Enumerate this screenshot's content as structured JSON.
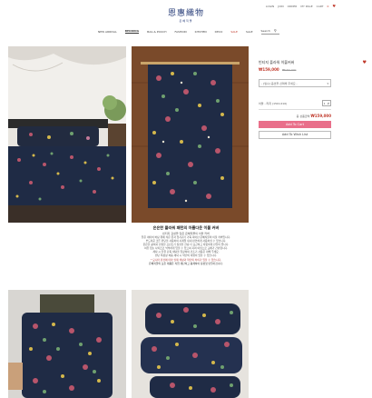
{
  "util": {
    "links": [
      "LOGIN",
      "JOIN",
      "ORDER",
      "MY PAGE",
      "CART"
    ],
    "cart_count": "0",
    "wish_icon": "heart-icon"
  },
  "logo": {
    "title": "恩惠織物",
    "subtitle": "은혜직물"
  },
  "nav": {
    "items": [
      "NEW ARRIVAL",
      "BEDDING",
      "BAG & POUCH",
      "FASHION",
      "KITCHEN",
      "DECO",
      "SALE",
      "SALE"
    ],
    "active_index": 1,
    "search_label": "Search",
    "search_icon": "magnifier-icon"
  },
  "product": {
    "name": "빈티지 플라워 이불커버",
    "price": "₩159,000",
    "original_price": "₩180,000",
    "select_placeholder": "- [필수] 옵션을 선택해 주세요 -",
    "option_label": "이불 - 라지 (150×210)",
    "qty": "1",
    "total_label": "총 상품금액",
    "total_value": "₩159,000",
    "cart_button": "Add To Cart",
    "wish_button": "Add To Wish List"
  },
  "description": {
    "title": "은은한 플라워 패턴의 아름다운 이불 커버",
    "subtitle": "빈티지 감성을 담은 은혜직물의 이불 커버",
    "lines": [
      "짙은 네이비 바탕 위에 작은 꽃과 잎사귀가 가득 피어난 은혜직물의 이불 커버입니다.",
      "부드러운 코튼 원단을 사용하여 사계절 내내 편안하게 사용하실 수 있습니다.",
      "은은한 광택과 선명한 프린트가 침실을 한층 더 포근하고 따뜻하게 만들어 줍니다.",
      "여유 있는 사이즈로 넉넉하게 덮을 수 있으며 지퍼 여밈으로 교체가 간편합니다.",
      "세탁 시 찬물 단독 세탁을 권장하며 건조기 사용은 피해 주세요.",
      "원단 특성상 처음 세탁 시 약간의 이염이 있을 수 있습니다."
    ],
    "notice_red": "* 모니터 환경에 따라 실제 색상과 약간의 차이가 있을 수 있습니다.",
    "notice_dark": "은혜직물의 모든 제품은 직접 재단하고 봉제하여 정성껏 만들어집니다."
  },
  "colors": {
    "accent": "#e96f8a",
    "price": "#c0392b",
    "logo": "#2a3f7a",
    "fabric": "#1f2b45"
  }
}
